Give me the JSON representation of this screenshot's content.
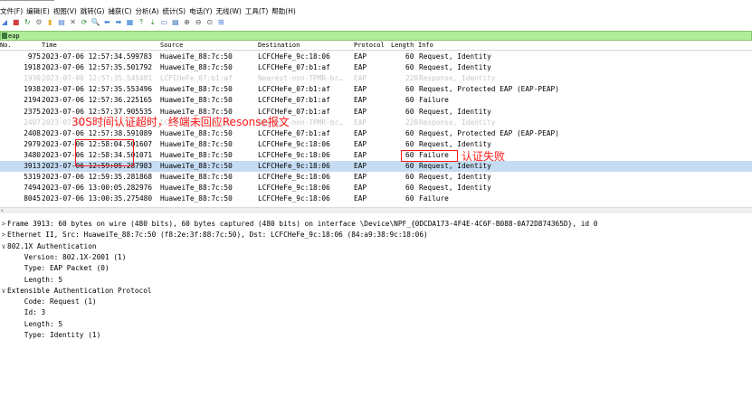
{
  "menubar": [
    "文件(F)",
    "编辑(E)",
    "视图(V)",
    "跳转(G)",
    "捕获(C)",
    "分析(A)",
    "统计(S)",
    "电话(Y)",
    "无线(W)",
    "工具(T)",
    "帮助(H)"
  ],
  "toolbar": {
    "icons": [
      "shark-fin-icon",
      "stop-icon",
      "restart-icon",
      "options-icon",
      "open-file-icon",
      "save-icon",
      "close-file-icon",
      "reload-icon",
      "find-icon",
      "back-icon",
      "forward-icon",
      "go-to-icon",
      "first-icon",
      "last-icon",
      "autoscroll-icon",
      "colorize-icon",
      "zoom-in-icon",
      "zoom-out-icon",
      "zoom-reset-icon",
      "resize-columns-icon"
    ],
    "glyphs": [
      "◢",
      "■",
      "↻",
      "⚙",
      "▮",
      "▤",
      "✕",
      "⟳",
      "🔍",
      "⬅",
      "➡",
      "▦",
      "⤒",
      "⤓",
      "▭",
      "▤",
      "⊕",
      "⊖",
      "⊙",
      "⊞"
    ],
    "colors": [
      "#4b7bd4",
      "#d04040",
      "#2a8a2a",
      "#777777",
      "#e4b332",
      "#4b7bd4",
      "#555555",
      "#2a8a2a",
      "#555555",
      "#2d7ad6",
      "#2d7ad6",
      "#2d7ad6",
      "#2a8a2a",
      "#2a8a2a",
      "#4b7bd4",
      "#2a6ab0",
      "#555555",
      "#555555",
      "#555555",
      "#4b7bd4"
    ]
  },
  "filter": {
    "value": "eap"
  },
  "columns": {
    "no": "No.",
    "time": "Time",
    "source": "Source",
    "destination": "Destination",
    "protocol": "Protocol",
    "length": "Length",
    "info": "Info"
  },
  "packets": [
    {
      "no": "975",
      "time": "2023-07-06 12:57:34.599783",
      "source": "HuaweiTe_88:7c:50",
      "destination": "LCFCHeFe_9c:18:06",
      "protocol": "EAP",
      "length": "60",
      "info": "Request, Identity",
      "dim": false,
      "selected": false
    },
    {
      "no": "1918",
      "time": "2023-07-06 12:57:35.501792",
      "source": "HuaweiTe_88:7c:50",
      "destination": "LCFCHeFe_07:b1:af",
      "protocol": "EAP",
      "length": "60",
      "info": "Request, Identity",
      "dim": false,
      "selected": false
    },
    {
      "no": "1930",
      "time": "2023-07-06 12:57:35.545481",
      "source": "LCFCHeFe_07:b1:af",
      "destination": "Nearest-non-TPMR-br…",
      "protocol": "EAP",
      "length": "220",
      "info": "Response, Identity",
      "dim": true,
      "selected": false
    },
    {
      "no": "1938",
      "time": "2023-07-06 12:57:35.553496",
      "source": "HuaweiTe_88:7c:50",
      "destination": "LCFCHeFe_07:b1:af",
      "protocol": "EAP",
      "length": "60",
      "info": "Request, Protected EAP (EAP-PEAP)",
      "dim": false,
      "selected": false
    },
    {
      "no": "2194",
      "time": "2023-07-06 12:57:36.225165",
      "source": "HuaweiTe_88:7c:50",
      "destination": "LCFCHeFe_07:b1:af",
      "protocol": "EAP",
      "length": "60",
      "info": "Failure",
      "dim": false,
      "selected": false
    },
    {
      "no": "2375",
      "time": "2023-07-06 12:57:37.905535",
      "source": "HuaweiTe_88:7c:50",
      "destination": "LCFCHeFe_07:b1:af",
      "protocol": "EAP",
      "length": "60",
      "info": "Request, Identity",
      "dim": false,
      "selected": false
    },
    {
      "no": "2407",
      "time": "2023-07-06 12:57:37.949529",
      "source": "LCFCHeFe_07:b1:af",
      "destination": "Nearest-non-TPMR-br…",
      "protocol": "EAP",
      "length": "220",
      "info": "Response, Identity",
      "dim": true,
      "selected": false
    },
    {
      "no": "2408",
      "time": "2023-07-06 12:57:38.591089",
      "source": "HuaweiTe_88:7c:50",
      "destination": "LCFCHeFe_07:b1:af",
      "protocol": "EAP",
      "length": "60",
      "info": "Request, Protected EAP (EAP-PEAP)",
      "dim": false,
      "selected": false
    },
    {
      "no": "2979",
      "time": "2023-07-06 12:58:04.501607",
      "source": "HuaweiTe_88:7c:50",
      "destination": "LCFCHeFe_9c:18:06",
      "protocol": "EAP",
      "length": "60",
      "info": "Request, Identity",
      "dim": false,
      "selected": false
    },
    {
      "no": "3480",
      "time": "2023-07-06 12:58:34.501071",
      "source": "HuaweiTe_88:7c:50",
      "destination": "LCFCHeFe_9c:18:06",
      "protocol": "EAP",
      "length": "60",
      "info": "Failure",
      "dim": false,
      "selected": false
    },
    {
      "no": "3913",
      "time": "2023-07-06 12:59:05.287983",
      "source": "HuaweiTe_88:7c:50",
      "destination": "LCFCHeFe_9c:18:06",
      "protocol": "EAP",
      "length": "60",
      "info": "Request, Identity",
      "dim": false,
      "selected": true
    },
    {
      "no": "5319",
      "time": "2023-07-06 12:59:35.281868",
      "source": "HuaweiTe_88:7c:50",
      "destination": "LCFCHeFe_9c:18:06",
      "protocol": "EAP",
      "length": "60",
      "info": "Request, Identity",
      "dim": false,
      "selected": false
    },
    {
      "no": "7494",
      "time": "2023-07-06 13:00:05.282976",
      "source": "HuaweiTe_88:7c:50",
      "destination": "LCFCHeFe_9c:18:06",
      "protocol": "EAP",
      "length": "60",
      "info": "Request, Identity",
      "dim": false,
      "selected": false
    },
    {
      "no": "8045",
      "time": "2023-07-06 13:00:35.275480",
      "source": "HuaweiTe_88:7c:50",
      "destination": "LCFCHeFe_9c:18:06",
      "protocol": "EAP",
      "length": "60",
      "info": "Failure",
      "dim": false,
      "selected": false
    }
  ],
  "details": [
    {
      "tw": ">",
      "text": "Frame 3913: 60 bytes on wire (480 bits), 60 bytes captured (480 bits) on interface \\Device\\NPF_{0DCDA173-4F4E-4C6F-B088-0A72D874365D}, id 0"
    },
    {
      "tw": ">",
      "text": "Ethernet II, Src: HuaweiTe_88:7c:50 (f8:2e:3f:88:7c:50), Dst: LCFCHeFe_9c:18:06 (84:a9:38:9c:18:06)"
    },
    {
      "tw": "∨",
      "text": "802.1X Authentication"
    },
    {
      "tw": "",
      "text": "    Version: 802.1X-2001 (1)"
    },
    {
      "tw": "",
      "text": "    Type: EAP Packet (0)"
    },
    {
      "tw": "",
      "text": "    Length: 5"
    },
    {
      "tw": "∨",
      "text": "Extensible Authentication Protocol"
    },
    {
      "tw": "",
      "text": "    Code: Request (1)"
    },
    {
      "tw": "",
      "text": "    Id: 3"
    },
    {
      "tw": "",
      "text": "    Length: 5"
    },
    {
      "tw": "",
      "text": "    Type: Identity (1)"
    }
  ],
  "annotations": {
    "timeout_text": "30S时间认证超时，终端未回应Resonse报文",
    "failure_text": "认证失败",
    "color": "#ff1a1a"
  }
}
